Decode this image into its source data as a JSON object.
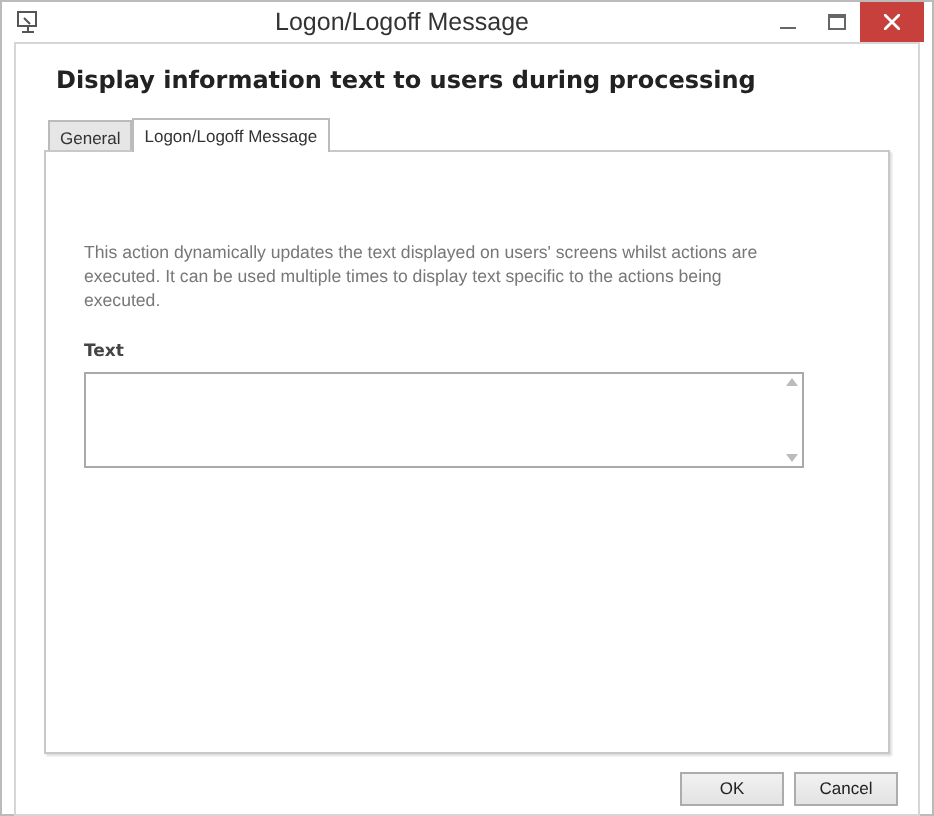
{
  "window": {
    "title": "Logon/Logoff Message"
  },
  "heading": "Display information text to users during processing",
  "tabs": [
    {
      "label": "General",
      "selected": false
    },
    {
      "label": "Logon/Logoff Message",
      "selected": true
    }
  ],
  "description": "This action dynamically updates the text displayed on users' screens whilst actions are executed. It can be used multiple times to display text specific to the actions being executed.",
  "text_field": {
    "label": "Text"
  },
  "buttons": [
    {
      "label": "OK"
    },
    {
      "label": "Cancel"
    }
  ]
}
